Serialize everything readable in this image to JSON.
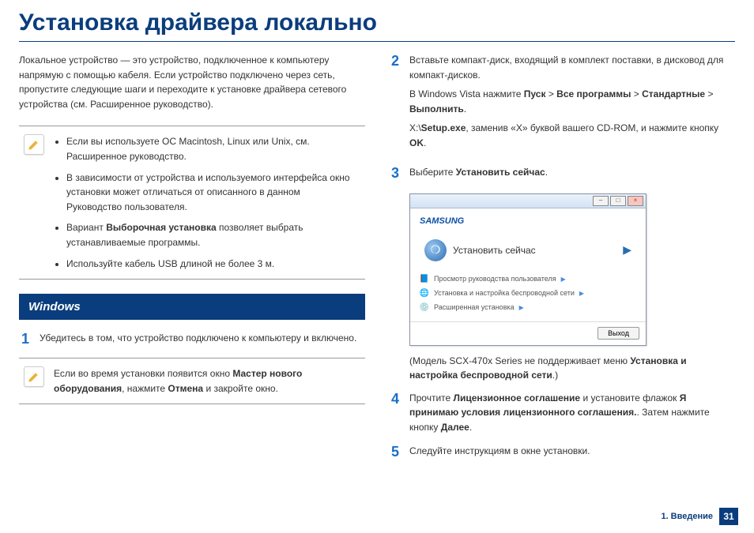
{
  "title": "Установка драйвера локально",
  "intro": "Локальное устройство — это устройство, подключенное к компьютеру напрямую с помощью кабеля. Если устройство подключено через сеть, пропустите следующие шаги и переходите к установке драйвера сетевого устройства (см. Расширенное руководство).",
  "note1": {
    "li1_a": "Если вы используете ОС Macintosh, Linux или Unix, см. ",
    "li1_b": "Расширенное",
    "li1_c": " руководство.",
    "li2_a": "В зависимости от устройства и используемого интерфейса окно установки может отличаться от описанного в данном ",
    "li2_b": "Руководство пользователя",
    "li2_c": ".",
    "li3_a": "Вариант ",
    "li3_b": "Выборочная установка",
    "li3_c": " позволяет выбрать устанавливаемые программы.",
    "li4": "Используйте кабель USB длиной не более 3 м."
  },
  "section_windows": "Windows",
  "step1": "Убедитесь в том, что устройство подключено к компьютеру и включено.",
  "note2_a": "Если во время установки появится окно ",
  "note2_b": "Мастер нового оборудования",
  "note2_c": ", нажмите ",
  "note2_d": "Отмена",
  "note2_e": " и закройте окно.",
  "step2_p1": "Вставьте компакт-диск, входящий в комплект поставки, в дисковод для компакт-дисков.",
  "step2_p2_a": "В Windows Vista нажмите ",
  "step2_p2_b": "Пуск",
  "step2_p2_c": " > ",
  "step2_p2_d": "Все программы",
  "step2_p2_e": " > ",
  "step2_p2_f": "Стандартные",
  "step2_p2_g": " > ",
  "step2_p2_h": "Выполнить",
  "step2_p2_i": ".",
  "step2_p3_a": "X:\\",
  "step2_p3_b": "Setup.exe",
  "step2_p3_c": ", заменив «X» буквой вашего CD-ROM, и нажмите кнопку ",
  "step2_p3_d": "OK",
  "step2_p3_e": ".",
  "step3_a": "Выберите ",
  "step3_b": "Установить сейчас",
  "step3_c": ".",
  "dialog": {
    "brand": "SAMSUNG",
    "install_now": "Установить сейчас",
    "opt1": "Просмотр руководства пользователя",
    "opt2": "Установка и настройка беспроводной сети",
    "opt3": "Расширенная установка",
    "exit": "Выход"
  },
  "step3_note_a": "(Модель SCX-470x Series не поддерживает меню ",
  "step3_note_b": "Установка и настройка беспроводной сети",
  "step3_note_c": ".)",
  "step4_a": "Прочтите ",
  "step4_b": "Лицензионное соглашение",
  "step4_c": " и установите флажок ",
  "step4_d": "Я принимаю условия лицензионного соглашения.",
  "step4_e": ". Затем нажмите кнопку ",
  "step4_f": "Далее",
  "step4_g": ".",
  "step5": "Следуйте инструкциям в окне установки.",
  "footer_chapter": "1. Введение",
  "page_num": "31",
  "nums": {
    "n1": "1",
    "n2": "2",
    "n3": "3",
    "n4": "4",
    "n5": "5"
  }
}
